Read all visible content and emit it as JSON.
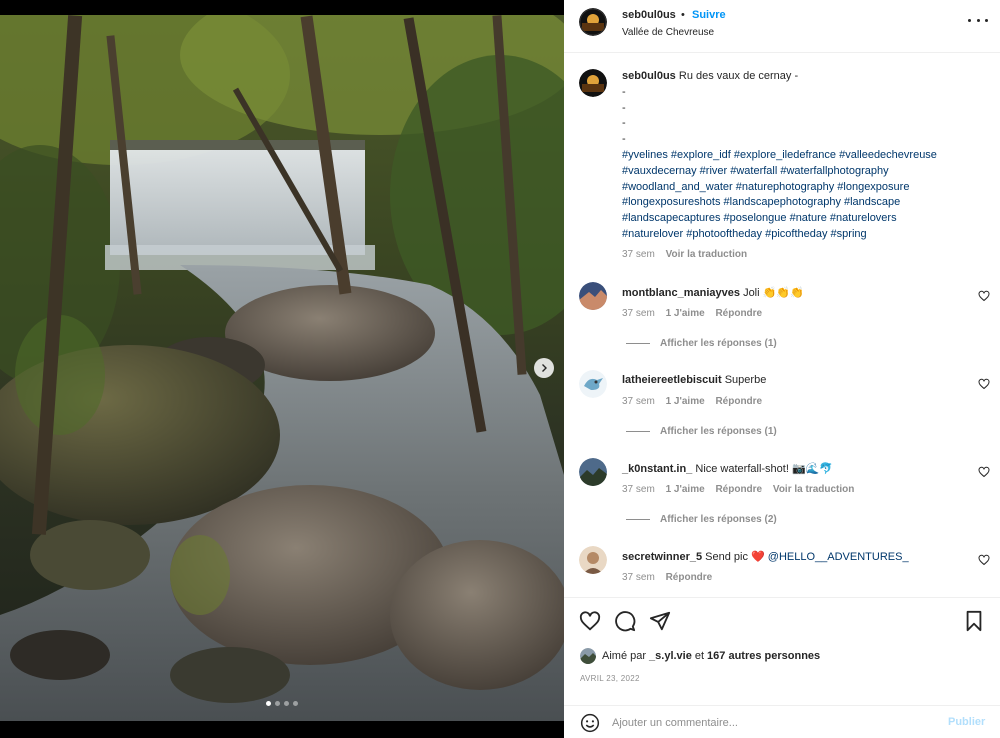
{
  "post": {
    "username": "seb0ul0us",
    "separator": "•",
    "follow_label": "Suivre",
    "location": "Vallée de Chevreuse",
    "more_icon": "more-horizontal-icon"
  },
  "media": {
    "description_icon": "photo-waterfall-forest",
    "next_icon": "chevron-right-icon",
    "carousel_total": 4,
    "carousel_active": 1
  },
  "caption": {
    "username": "seb0ul0us",
    "text": "Ru des vaux de cernay -",
    "dashes": [
      "-",
      "-",
      "-",
      "-"
    ],
    "hashtag_lines": [
      "#yvelines #explore_idf #explore_iledefrance #valleedechevreuse",
      "#vauxdecernay #river #waterfall #waterfallphotography",
      "#woodland_and_water #naturephotography #longexposure",
      "#longexposureshots #landscapephotography #landscape",
      "#landscapecaptures #poselongue #nature #naturelovers",
      "#naturelover #photooftheday #picoftheday #spring"
    ],
    "time": "37 sem",
    "translate": "Voir la traduction"
  },
  "comments": [
    {
      "username": "montblanc_maniayves",
      "text": "Joli 👏👏👏",
      "time": "37 sem",
      "likes": "1 J'aime",
      "reply": "Répondre",
      "translate": "",
      "replies": "Afficher les réponses (1)"
    },
    {
      "username": "latheiereetlebiscuit",
      "text": "Superbe",
      "time": "37 sem",
      "likes": "1 J'aime",
      "reply": "Répondre",
      "translate": "",
      "replies": "Afficher les réponses (1)"
    },
    {
      "username": "_k0nstant.in_",
      "text": "Nice waterfall-shot! 📷🌊🐬",
      "time": "37 sem",
      "likes": "1 J'aime",
      "reply": "Répondre",
      "translate": "Voir la traduction",
      "replies": "Afficher les réponses (2)"
    },
    {
      "username": "secretwinner_5",
      "text": "Send pic ❤️",
      "mention": "@HELLO__ADVENTURES_",
      "time": "37 sem",
      "likes": "",
      "reply": "Répondre",
      "translate": "",
      "replies": ""
    }
  ],
  "actions": {
    "like_icon": "heart-icon",
    "comment_icon": "comment-icon",
    "share_icon": "send-icon",
    "save_icon": "bookmark-icon"
  },
  "likes": {
    "prefix": "Aimé par",
    "user": "_s.yl.vie",
    "middle": "et",
    "others": "167 autres personnes"
  },
  "date": "AVRIL 23, 2022",
  "add_comment": {
    "placeholder": "Ajouter un commentaire...",
    "publish_label": "Publier",
    "emoji_icon": "smiley-icon"
  },
  "colors": {
    "accent": "#0095f6",
    "link": "#00376b",
    "muted": "#8e8e8e",
    "publish_disabled": "#b2dffc",
    "heart": "#ed4956"
  }
}
